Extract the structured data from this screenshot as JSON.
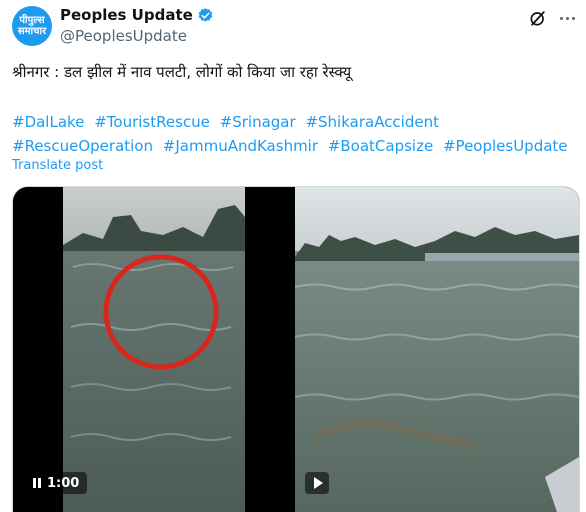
{
  "author": {
    "avatar_line1": "पीपुल्स",
    "avatar_line2": "समाचार",
    "display_name": "Peoples Update",
    "handle": "@PeoplesUpdate"
  },
  "post": {
    "text": "श्रीनगर : डल झील में नाव पलटी, लोगों को किया जा रहा रेस्क्यू",
    "hashtags": [
      "#DalLake",
      "#TouristRescue",
      "#Srinagar",
      "#ShikaraAccident",
      "#RescueOperation",
      "#JammuAndKashmir",
      "#BoatCapsize",
      "#PeoplesUpdate"
    ],
    "translate_label": "Translate post"
  },
  "media": {
    "video1": {
      "duration": "1:00",
      "control_icon": "pause-icon"
    },
    "video2": {
      "control_icon": "play-icon"
    }
  },
  "icons": {
    "verified": "verified-badge-icon",
    "grok": "grok-icon",
    "more": "more-icon"
  },
  "colors": {
    "accent": "#1d9bf0",
    "text": "#0f1419",
    "secondary": "#536471",
    "marker": "#d9261c"
  }
}
